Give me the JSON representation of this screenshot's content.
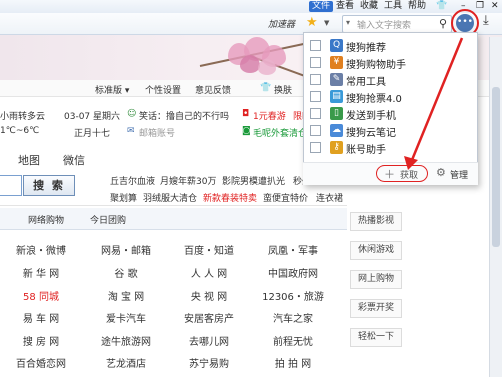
{
  "menubar": {
    "items": [
      "文件",
      "查看",
      "收藏",
      "工具",
      "帮助"
    ]
  },
  "window": {
    "minimize": "–",
    "restore": "❐",
    "close": "✕"
  },
  "toolbar": {
    "accelerator": "加速器",
    "search_placeholder": "输入文字搜索"
  },
  "topnav": {
    "items": [
      "标准版 ▾",
      "个性设置",
      "意见反馈",
      "换肤"
    ]
  },
  "info": {
    "weather1": "小雨转多云",
    "temp": "1℃~6℃",
    "date": "03-07 星期六",
    "lunar": "正月十七",
    "joke": "笑话：撸自己的不行吗",
    "mail": "邮箱账号",
    "red_ad": "1元春游",
    "green_ad": "毛呢外套清仓",
    "cut": "限时"
  },
  "search_tabs": [
    "地图",
    "微信"
  ],
  "search_button": "搜 索",
  "hot_links": {
    "row1": [
      "丘吉尔血液",
      "月嫂年薪30万",
      "影院男模遭扒光",
      "秒州"
    ],
    "row2": [
      "聚划算",
      "羽绒服大清仓",
      "新款春装特卖",
      "蛮便宜特价",
      "连衣裙"
    ]
  },
  "category_tabs": [
    "网络购物",
    "今日团购"
  ],
  "sites": [
    [
      "新浪・微博",
      "网易・邮箱",
      "百度・知道",
      "凤凰・军事"
    ],
    [
      "新 华 网",
      "谷  歌",
      "人 人 网",
      "中国政府网"
    ],
    [
      "58 同城",
      "淘 宝 网",
      "央 视 网",
      "12306・旅游"
    ],
    [
      "易 车 网",
      "爱卡汽车",
      "安居客房产",
      "汽车之家"
    ],
    [
      "搜 房 网",
      "途牛旅游网",
      "去哪儿网",
      "前程无忧"
    ],
    [
      "百合婚恋网",
      "艺龙酒店",
      "苏宁易购",
      "拍 拍 网"
    ]
  ],
  "sidebar_links": [
    "热播影视",
    "休闲游戏",
    "网上购物",
    "彩票开奖",
    "轻松一下"
  ],
  "dropdown": {
    "items": [
      {
        "label": "搜狗推荐",
        "icon": "search-icon",
        "color": "#3a78c8"
      },
      {
        "label": "搜狗购物助手",
        "icon": "cart-icon",
        "color": "#e08020"
      },
      {
        "label": "常用工具",
        "icon": "wrench-icon",
        "color": "#6b7fa6"
      },
      {
        "label": "搜狗抢票4.0",
        "icon": "ticket-icon",
        "color": "#3a9ad8"
      },
      {
        "label": "发送到手机",
        "icon": "phone-icon",
        "color": "#3a9a4a"
      },
      {
        "label": "搜狗云笔记",
        "icon": "cloud-icon",
        "color": "#4a8ad8"
      },
      {
        "label": "账号助手",
        "icon": "key-icon",
        "color": "#e0a020"
      }
    ],
    "get_label": "获取",
    "manage_label": "管理"
  },
  "colors": {
    "accent": "#2f6fd0",
    "annotation": "#e02222"
  }
}
